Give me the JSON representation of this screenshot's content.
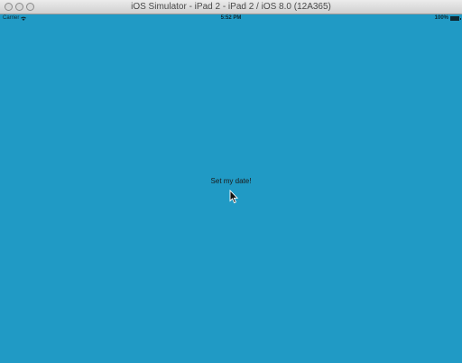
{
  "window": {
    "title": "iOS Simulator - iPad 2 - iPad 2 / iOS 8.0 (12A365)"
  },
  "statusbar": {
    "carrier": "Carrier",
    "time": "5:52 PM",
    "battery": "100%"
  },
  "main": {
    "button_label": "Set my date!"
  },
  "colors": {
    "background": "#209ac5",
    "titlebar": "#dcdcdc"
  },
  "icons": {
    "wifi": "wifi-icon",
    "battery": "battery-icon",
    "cursor": "cursor-icon"
  }
}
